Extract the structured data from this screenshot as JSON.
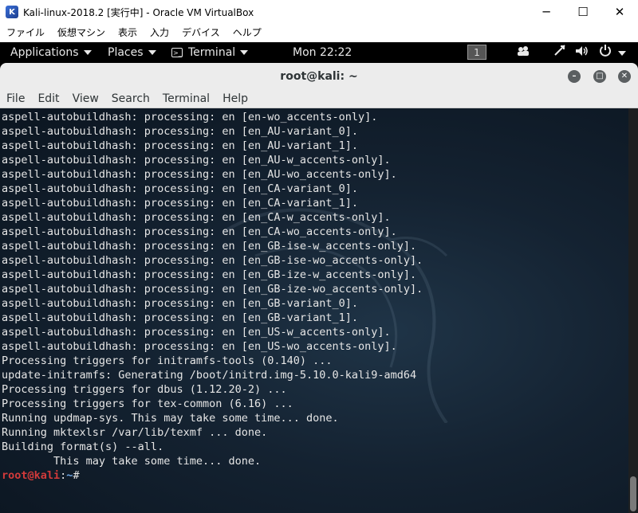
{
  "host": {
    "title": "Kali-linux-2018.2 [実行中] - Oracle VM VirtualBox",
    "menu": [
      "ファイル",
      "仮想マシン",
      "表示",
      "入力",
      "デバイス",
      "ヘルプ"
    ],
    "controls": {
      "minimize": "─",
      "maximize": "☐",
      "close": "✕"
    }
  },
  "gnome": {
    "applications": "Applications",
    "places": "Places",
    "terminal": "Terminal",
    "clock": "Mon 22:22",
    "workspace": "1"
  },
  "terminal": {
    "title": "root@kali: ~",
    "menu": [
      "File",
      "Edit",
      "View",
      "Search",
      "Terminal",
      "Help"
    ],
    "lines": [
      "aspell-autobuildhash: processing: en [en-wo_accents-only].",
      "aspell-autobuildhash: processing: en [en_AU-variant_0].",
      "aspell-autobuildhash: processing: en [en_AU-variant_1].",
      "aspell-autobuildhash: processing: en [en_AU-w_accents-only].",
      "aspell-autobuildhash: processing: en [en_AU-wo_accents-only].",
      "aspell-autobuildhash: processing: en [en_CA-variant_0].",
      "aspell-autobuildhash: processing: en [en_CA-variant_1].",
      "aspell-autobuildhash: processing: en [en_CA-w_accents-only].",
      "aspell-autobuildhash: processing: en [en_CA-wo_accents-only].",
      "aspell-autobuildhash: processing: en [en_GB-ise-w_accents-only].",
      "aspell-autobuildhash: processing: en [en_GB-ise-wo_accents-only].",
      "aspell-autobuildhash: processing: en [en_GB-ize-w_accents-only].",
      "aspell-autobuildhash: processing: en [en_GB-ize-wo_accents-only].",
      "aspell-autobuildhash: processing: en [en_GB-variant_0].",
      "aspell-autobuildhash: processing: en [en_GB-variant_1].",
      "aspell-autobuildhash: processing: en [en_US-w_accents-only].",
      "aspell-autobuildhash: processing: en [en_US-wo_accents-only].",
      "Processing triggers for initramfs-tools (0.140) ...",
      "update-initramfs: Generating /boot/initrd.img-5.10.0-kali9-amd64",
      "Processing triggers for dbus (1.12.20-2) ...",
      "Processing triggers for tex-common (6.16) ...",
      "Running updmap-sys. This may take some time... done.",
      "Running mktexlsr /var/lib/texmf ... done.",
      "Building format(s) --all.",
      "        This may take some time... done."
    ],
    "prompt": {
      "user": "root@kali",
      "sep": ":",
      "path": "~",
      "symbol": "#"
    }
  },
  "colors": {
    "prompt_user": "#d23a3a",
    "prompt_path": "#6fa8e6",
    "terminal_bg": "#142231"
  }
}
